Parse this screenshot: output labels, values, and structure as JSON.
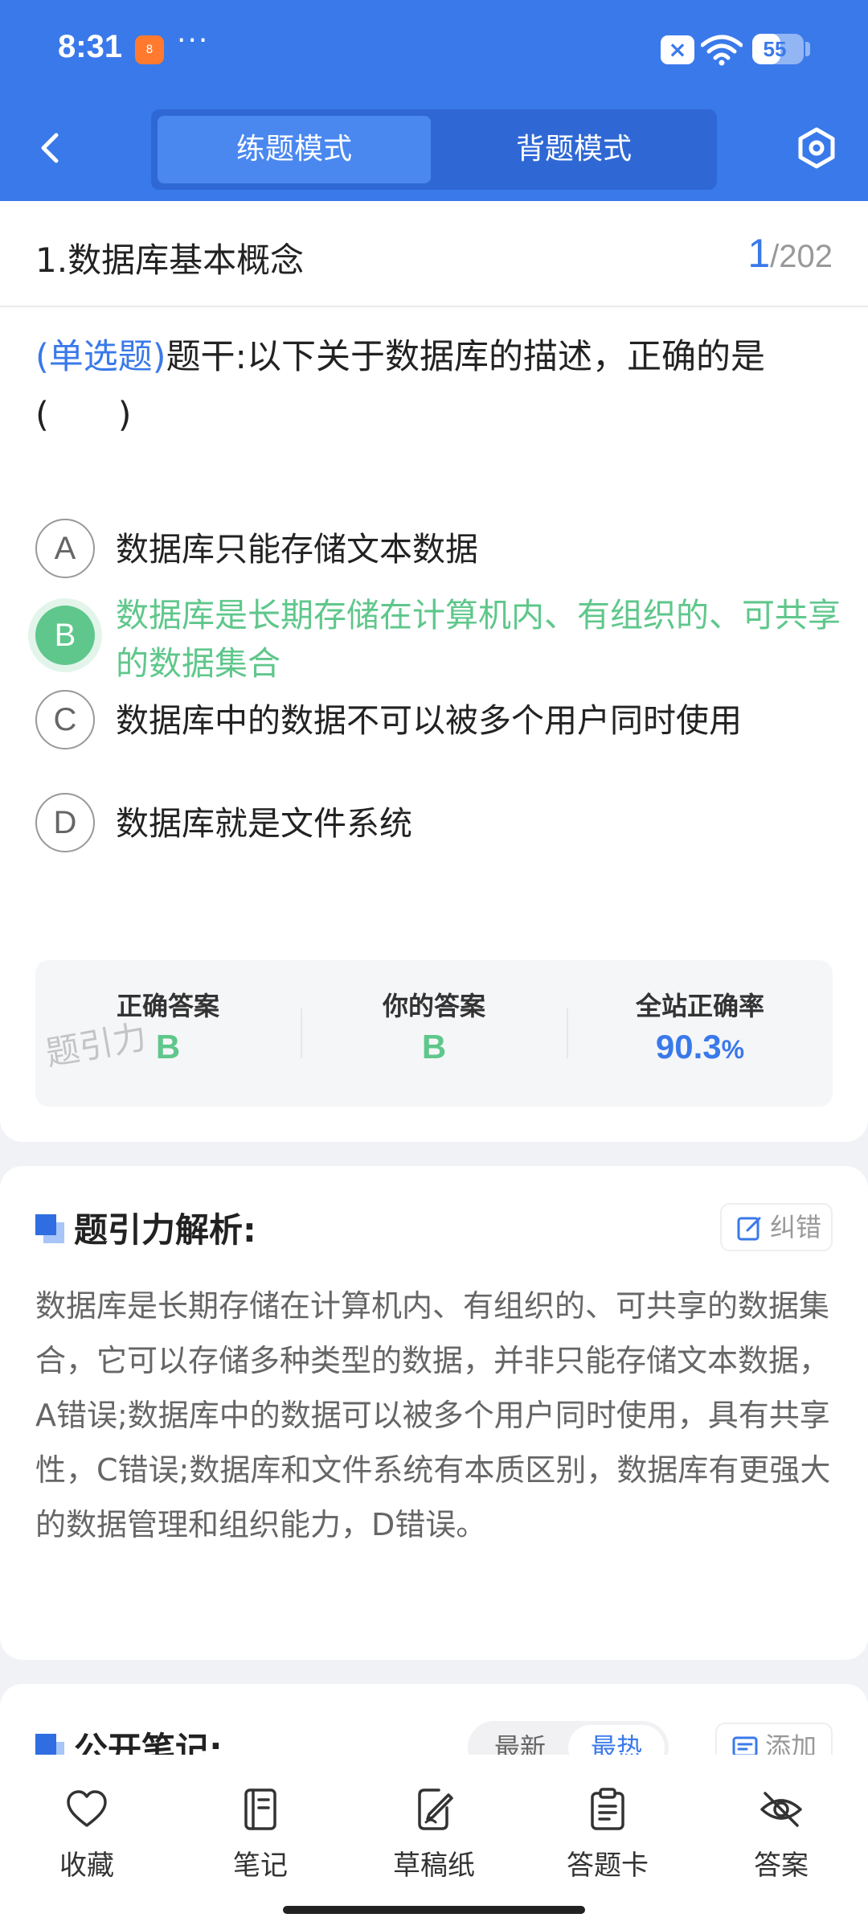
{
  "status_bar": {
    "time": "8:31",
    "app_badge": "8",
    "dots": "···",
    "battery": 55
  },
  "header": {
    "tabs": {
      "practice": "练题模式",
      "memorize": "背题模式"
    }
  },
  "question_card": {
    "chapter_title": "1.数据库基本概念",
    "page_current": "1",
    "page_separator": "/",
    "page_total": "202",
    "question_type": "(单选题)",
    "question_text": "题干:以下关于数据库的描述，正确的是(　　)",
    "options": [
      {
        "letter": "A",
        "text": "数据库只能存储文本数据"
      },
      {
        "letter": "B",
        "text": "数据库是长期存储在计算机内、有组织的、可共享的数据集合"
      },
      {
        "letter": "C",
        "text": "数据库中的数据不可以被多个用户同时使用"
      },
      {
        "letter": "D",
        "text": "数据库就是文件系统"
      }
    ],
    "stats": {
      "correct_label": "正确答案",
      "correct_value": "B",
      "yours_label": "你的答案",
      "yours_value": "B",
      "rate_label": "全站正确率",
      "rate_value": "90.3",
      "rate_unit": "%"
    },
    "watermark": "题引力"
  },
  "analysis": {
    "title": "题引力解析:",
    "report_label": "纠错",
    "text": "数据库是长期存储在计算机内、有组织的、可共享的数据集合，它可以存储多种类型的数据，并非只能存储文本数据，A错误;数据库中的数据可以被多个用户同时使用，具有共享性，C错误;数据库和文件系统有本质区别，数据库有更强大的数据管理和组织能力，D错误。"
  },
  "notes": {
    "title": "公开笔记:",
    "sort_latest": "最新",
    "sort_hot": "最热",
    "add_label": "添加"
  },
  "bottom_nav": {
    "favorite": "收藏",
    "notes": "笔记",
    "draft": "草稿纸",
    "answer_sheet": "答题卡",
    "answer": "答案"
  },
  "colors": {
    "primary": "#3a79ea",
    "correct": "#5fc78b"
  }
}
